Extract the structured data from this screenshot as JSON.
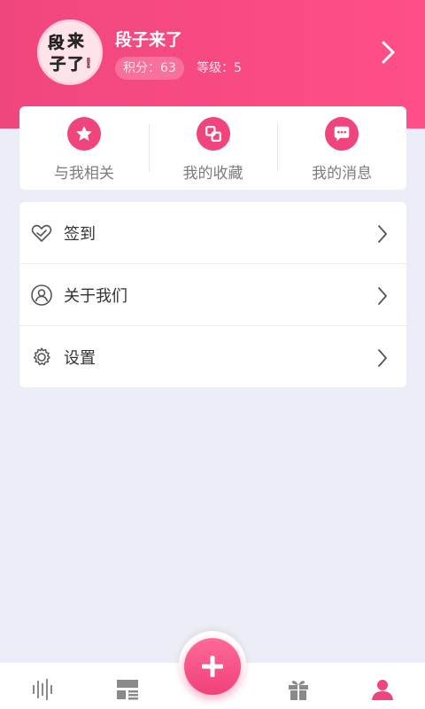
{
  "profile": {
    "avatar_text": "段子来了!",
    "username": "段子来了",
    "score_label": "积分：63",
    "level_label": "等级：5"
  },
  "quick_actions": [
    {
      "label": "与我相关",
      "icon": "star-icon"
    },
    {
      "label": "我的收藏",
      "icon": "collection-icon"
    },
    {
      "label": "我的消息",
      "icon": "message-icon"
    }
  ],
  "menu": [
    {
      "label": "签到",
      "icon": "heart-checkin-icon"
    },
    {
      "label": "关于我们",
      "icon": "about-user-icon"
    },
    {
      "label": "设置",
      "icon": "gear-icon"
    }
  ],
  "bottom_nav": [
    {
      "icon": "audio-wave-icon"
    },
    {
      "icon": "layout-list-icon"
    },
    {
      "icon": "plus-icon"
    },
    {
      "icon": "gift-icon"
    },
    {
      "icon": "profile-icon",
      "active": true
    }
  ],
  "colors": {
    "accent": "#f0447c",
    "header": "#ff4f86",
    "background": "#eceef7",
    "inactive_icon": "#8a8a8a"
  }
}
